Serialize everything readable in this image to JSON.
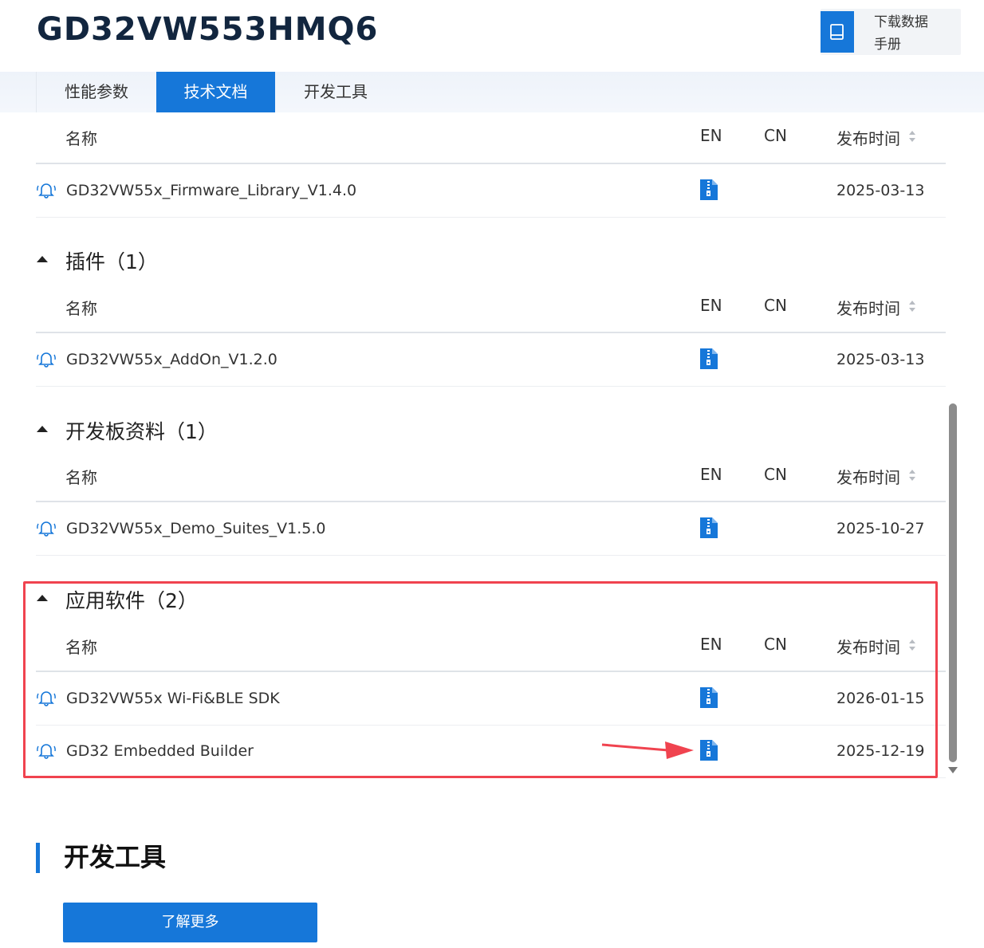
{
  "header": {
    "product_title": "GD32VW553HMQ6",
    "download_label_line1": "下载数据",
    "download_label_line2": "手册"
  },
  "tabs": [
    {
      "label": "性能参数",
      "active": false
    },
    {
      "label": "技术文档",
      "active": true
    },
    {
      "label": "开发工具",
      "active": false
    }
  ],
  "table_headers": {
    "name": "名称",
    "en": "EN",
    "cn": "CN",
    "date": "发布时间"
  },
  "sections": [
    {
      "title": "",
      "rows": [
        {
          "name": "GD32VW55x_Firmware_Library_V1.4.0",
          "date": "2025-03-13"
        }
      ]
    },
    {
      "title": "插件（1）",
      "rows": [
        {
          "name": "GD32VW55x_AddOn_V1.2.0",
          "date": "2025-03-13"
        }
      ]
    },
    {
      "title": "开发板资料（1）",
      "rows": [
        {
          "name": "GD32VW55x_Demo_Suites_V1.5.0",
          "date": "2025-10-27"
        }
      ]
    },
    {
      "title": "应用软件（2）",
      "rows": [
        {
          "name": "GD32VW55x Wi-Fi&BLE SDK",
          "date": "2026-01-15"
        },
        {
          "name": "GD32 Embedded Builder",
          "date": "2025-12-19"
        }
      ]
    }
  ],
  "dev_tools": {
    "title": "开发工具",
    "button": "了解更多"
  },
  "colors": {
    "accent": "#1677d9",
    "highlight": "#f0434f"
  },
  "icons": {
    "bell": "bell-icon",
    "file": "zip-file-icon",
    "book": "book-icon",
    "sort": "sort-icon"
  }
}
